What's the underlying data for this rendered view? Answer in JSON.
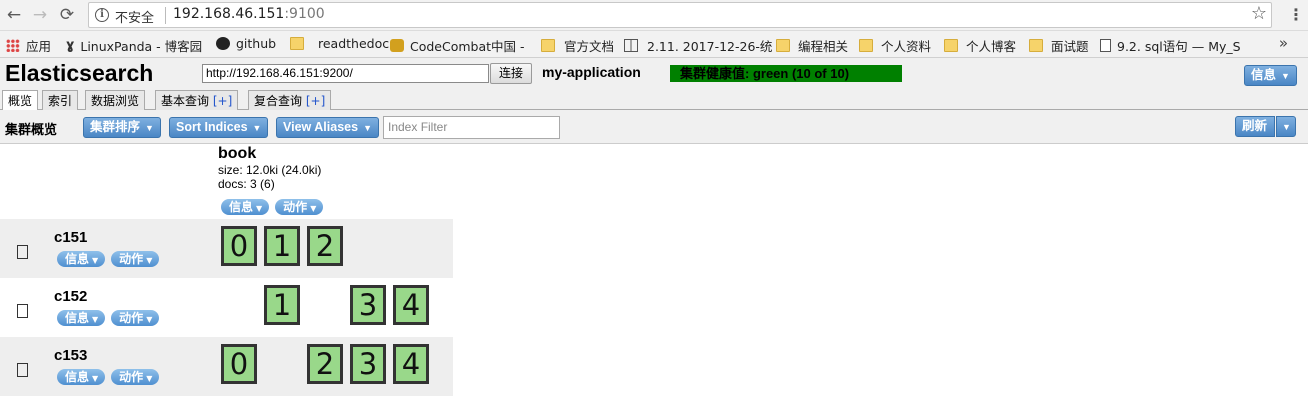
{
  "browser": {
    "back_icon": "←",
    "forward_icon": "→",
    "reload_icon": "⟳",
    "security_text": "不安全",
    "url_host": "192.168.46.151",
    "url_port": ":9100",
    "bookmarks": [
      {
        "label": "应用",
        "icon": "apps-icon"
      },
      {
        "label": "LinuxPanda - 博客园",
        "icon": "linuxpanda-icon"
      },
      {
        "label": "github",
        "icon": "github-icon"
      },
      {
        "label": "readthedoc",
        "icon": "folder-icon"
      },
      {
        "label": "CodeCombat中国 -",
        "icon": "codecombat-icon"
      },
      {
        "label": "官方文档",
        "icon": "folder-icon"
      },
      {
        "label": "2.11. 2017-12-26-统",
        "icon": "grid-icon"
      },
      {
        "label": "编程相关",
        "icon": "folder-icon"
      },
      {
        "label": "个人资料",
        "icon": "folder-icon"
      },
      {
        "label": "个人博客",
        "icon": "folder-icon"
      },
      {
        "label": "面试题",
        "icon": "folder-icon"
      },
      {
        "label": "9.2. sql语句 — My_S",
        "icon": "page-icon"
      }
    ]
  },
  "header": {
    "title": "Elasticsearch",
    "connect_url": "http://192.168.46.151:9200/",
    "connect_label": "连接",
    "cluster_name": "my-application",
    "health_text": "集群健康值: green (10 of 10)",
    "info_label": "信息"
  },
  "tabs": [
    {
      "label": "概览",
      "plus": ""
    },
    {
      "label": "索引",
      "plus": ""
    },
    {
      "label": "数据浏览",
      "plus": ""
    },
    {
      "label": "基本查询 ",
      "plus": "[+]"
    },
    {
      "label": "复合查询 ",
      "plus": "[+]"
    }
  ],
  "toolbar": {
    "title": "集群概览",
    "sort_cluster": "集群排序",
    "sort_indices": "Sort Indices",
    "view_aliases": "View Aliases",
    "filter_placeholder": "Index Filter",
    "refresh": "刷新"
  },
  "index": {
    "name": "book",
    "size": "size: 12.0ki (24.0ki)",
    "docs": "docs: 3 (6)",
    "info_label": "信息",
    "action_label": "动作"
  },
  "nodes": [
    {
      "name": "c151",
      "info_label": "信息",
      "action_label": "动作",
      "shards": [
        "0",
        "1",
        "2"
      ]
    },
    {
      "name": "c152",
      "info_label": "信息",
      "action_label": "动作",
      "shards": [
        "1",
        "3",
        "4"
      ]
    },
    {
      "name": "c153",
      "info_label": "信息",
      "action_label": "动作",
      "shards": [
        "0",
        "2",
        "3",
        "4"
      ]
    }
  ],
  "colors": {
    "health_green": "#008000",
    "shard_started": "#99d88a",
    "button_blue": "#4a86c5"
  }
}
